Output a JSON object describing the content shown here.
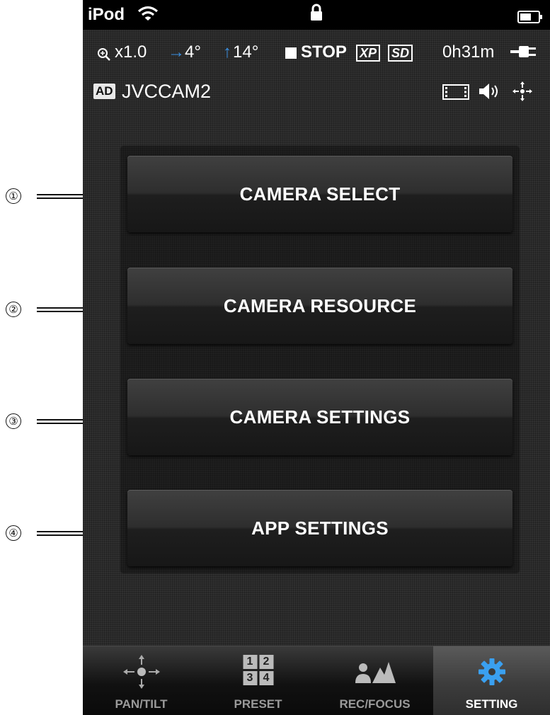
{
  "callouts": [
    "①",
    "②",
    "③",
    "④"
  ],
  "status_bar": {
    "carrier": "iPod",
    "wifi_icon": "wifi-icon",
    "lock_icon": "lock-icon",
    "battery_icon": "battery-icon"
  },
  "info_bar": {
    "zoom": "x1.0",
    "pan": "4°",
    "tilt": "14°",
    "record_status": "STOP",
    "format": "XP",
    "media": "SD",
    "remaining_time": "0h31m",
    "accent_color": "#3a8fe0"
  },
  "camera": {
    "badge": "AD",
    "name": "JVCCAM2"
  },
  "menu": {
    "camera_select": "CAMERA SELECT",
    "camera_resource": "CAMERA RESOURCE",
    "camera_settings": "CAMERA SETTINGS",
    "app_settings": "APP SETTINGS"
  },
  "tabs": [
    {
      "label": "PAN/TILT",
      "icon": "pan-tilt-icon",
      "active": false
    },
    {
      "label": "PRESET",
      "icon": "preset-grid-icon",
      "active": false
    },
    {
      "label": "REC/FOCUS",
      "icon": "rec-focus-icon",
      "active": false
    },
    {
      "label": "SETTING",
      "icon": "gear-icon",
      "active": true
    }
  ],
  "tab_numbers": [
    "1",
    "2",
    "3",
    "4"
  ]
}
